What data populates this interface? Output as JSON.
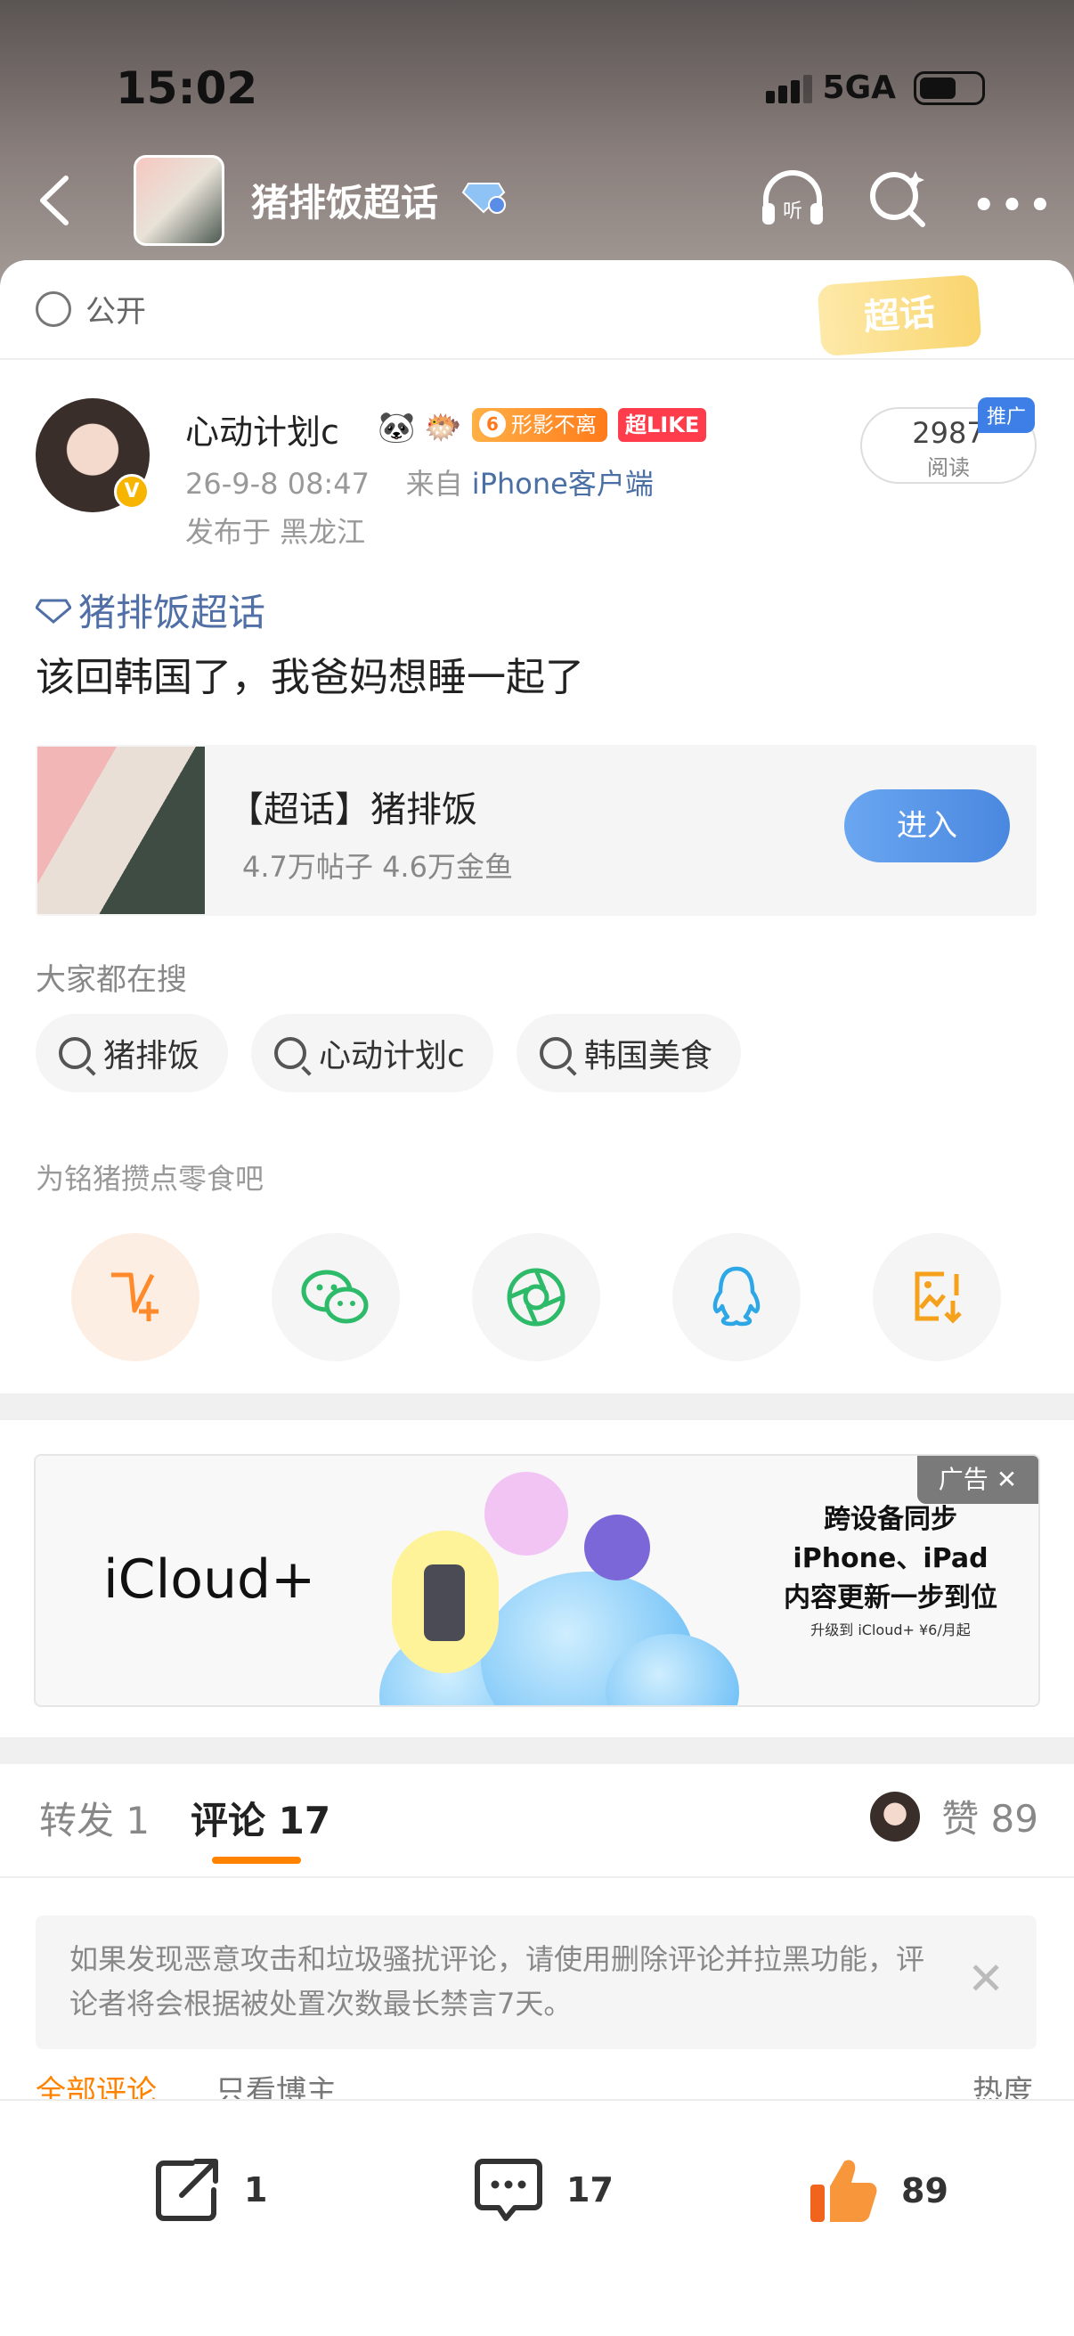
{
  "status_bar": {
    "time": "15:02",
    "network": "5GA"
  },
  "nav": {
    "title": "猪排饭超话"
  },
  "visibility": "公开",
  "chaohua_badge": "超话",
  "post": {
    "author": "心动计划c",
    "medal_label": "形影不离",
    "medal_level": "6",
    "like_badge": "超LIKE",
    "date": "26-9-8 08:47",
    "source_prefix": "来自",
    "source": "iPhone客户端",
    "location": "发布于 黑龙江",
    "read_count": "2987",
    "read_label": "阅读",
    "promo": "推广",
    "topic_tag": "猪排饭超话",
    "text": "该回韩国了，我爸妈想睡一起了"
  },
  "topic_card": {
    "name": "【超话】猪排饭",
    "stats": "4.7万帖子 4.6万金鱼",
    "enter": "进入"
  },
  "searches": {
    "label": "大家都在搜",
    "items": [
      "猪排饭",
      "心动计划c",
      "韩国美食"
    ]
  },
  "share": {
    "label": "为铭猪攒点零食吧",
    "icons": [
      "vplus-icon",
      "wechat-icon",
      "moments-icon",
      "qq-icon",
      "save-image-icon"
    ]
  },
  "ad": {
    "brand": "iCloud+",
    "line1": "跨设备同步",
    "line2": "iPhone、iPad",
    "line3": "内容更新一步到位",
    "line4": "升级到 iCloud+ ¥6/月起",
    "close": "广告"
  },
  "tabs": {
    "repost": "转发 1",
    "comments": "评论 17",
    "likes": "赞 89"
  },
  "notice": "如果发现恶意攻击和垃圾骚扰评论，请使用删除评论并拉黑功能，评论者将会根据被处置次数最长禁言7天。",
  "sort": {
    "all": "全部评论",
    "author_only": "只看博主",
    "hot": "热度"
  },
  "bottom": {
    "repost": "1",
    "comments": "17",
    "likes": "89"
  },
  "colors": {
    "accent": "#ff8200",
    "link": "#4f6fa6",
    "enter": "#4a88e0"
  }
}
